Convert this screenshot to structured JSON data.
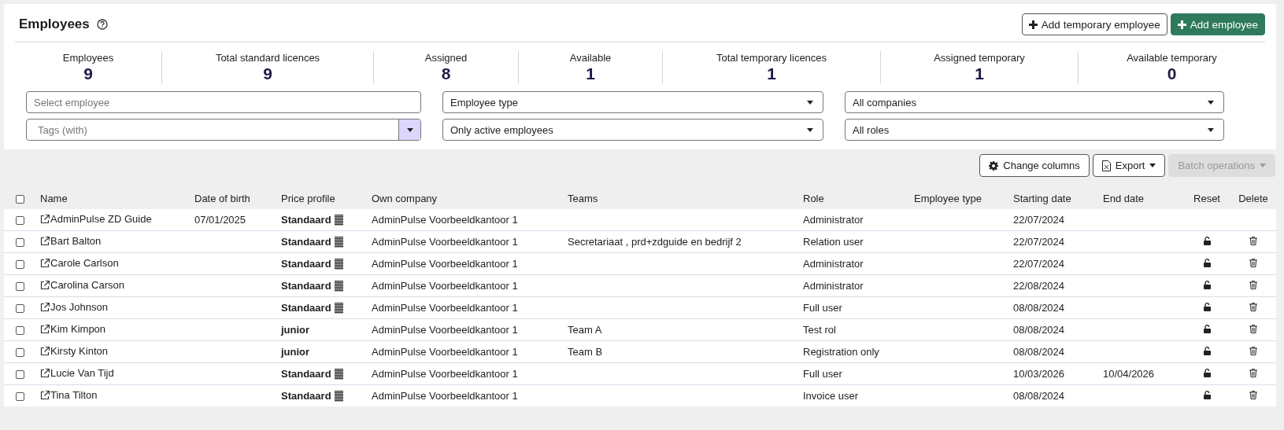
{
  "header": {
    "title": "Employees",
    "buttons": [
      {
        "label": "Add temporary employee",
        "kind": "secondary"
      },
      {
        "label": "Add employee",
        "kind": "primary"
      }
    ]
  },
  "stats": [
    {
      "label": "Employees",
      "value": "9"
    },
    {
      "label": "Total standard licences",
      "value": "9"
    },
    {
      "label": "Assigned",
      "value": "8"
    },
    {
      "label": "Available",
      "value": "1"
    },
    {
      "label": "Total temporary licences",
      "value": "1"
    },
    {
      "label": "Assigned temporary",
      "value": "1"
    },
    {
      "label": "Available temporary",
      "value": "0"
    }
  ],
  "filters": [
    {
      "kind": "text",
      "placeholder": "Select employee"
    },
    {
      "kind": "select",
      "value": "Employee type"
    },
    {
      "kind": "select",
      "value": "All companies"
    },
    {
      "kind": "tags",
      "placeholder": "Tags (with)"
    },
    {
      "kind": "select",
      "value": "Only active employees"
    },
    {
      "kind": "select",
      "value": "All roles"
    }
  ],
  "toolbar": [
    {
      "label": "Change columns",
      "kind": "columns",
      "disabled": false
    },
    {
      "label": "Export",
      "kind": "export",
      "disabled": false
    },
    {
      "label": "Batch operations",
      "kind": "batch",
      "disabled": true
    }
  ],
  "table": {
    "select_all_checked": false,
    "columns": [
      "Name",
      "Date of birth",
      "Price profile",
      "Own company",
      "Teams",
      "Role",
      "Employee type",
      "Starting date",
      "End date",
      "Reset",
      "Delete"
    ],
    "rows": [
      {
        "checked": false,
        "name": "AdminPulse ZD Guide",
        "date_of_birth": "07/01/2025",
        "price_profile": "Standaard",
        "price_icon": true,
        "own_company": "AdminPulse Voorbeeldkantoor 1",
        "teams": "",
        "role": "Administrator",
        "starting_date": "22/07/2024",
        "end_date": "",
        "resettable": false,
        "deletable": false
      },
      {
        "checked": false,
        "name": "Bart Balton",
        "date_of_birth": "",
        "price_profile": "Standaard",
        "price_icon": true,
        "own_company": "AdminPulse Voorbeeldkantoor 1",
        "teams": "Secretariaat , prd+zdguide en bedrijf 2",
        "role": "Relation user",
        "starting_date": "22/07/2024",
        "end_date": "",
        "resettable": true,
        "deletable": true
      },
      {
        "checked": false,
        "name": "Carole Carlson",
        "date_of_birth": "",
        "price_profile": "Standaard",
        "price_icon": true,
        "own_company": "AdminPulse Voorbeeldkantoor 1",
        "teams": "",
        "role": "Administrator",
        "starting_date": "22/07/2024",
        "end_date": "",
        "resettable": true,
        "deletable": true
      },
      {
        "checked": false,
        "name": "Carolina Carson",
        "date_of_birth": "",
        "price_profile": "Standaard",
        "price_icon": true,
        "own_company": "AdminPulse Voorbeeldkantoor 1",
        "teams": "",
        "role": "Administrator",
        "starting_date": "22/08/2024",
        "end_date": "",
        "resettable": true,
        "deletable": true
      },
      {
        "checked": false,
        "name": "Jos Johnson",
        "date_of_birth": "",
        "price_profile": "Standaard",
        "price_icon": true,
        "own_company": "AdminPulse Voorbeeldkantoor 1",
        "teams": "",
        "role": "Full user",
        "starting_date": "08/08/2024",
        "end_date": "",
        "resettable": true,
        "deletable": true
      },
      {
        "checked": false,
        "name": "Kim Kimpon",
        "date_of_birth": "",
        "price_profile": "junior",
        "price_icon": false,
        "own_company": "AdminPulse Voorbeeldkantoor 1",
        "teams": "Team A",
        "role": "Test rol",
        "starting_date": "08/08/2024",
        "end_date": "",
        "resettable": true,
        "deletable": true
      },
      {
        "checked": false,
        "name": "Kirsty Kinton",
        "date_of_birth": "",
        "price_profile": "junior",
        "price_icon": false,
        "own_company": "AdminPulse Voorbeeldkantoor 1",
        "teams": "Team B",
        "role": "Registration only",
        "starting_date": "08/08/2024",
        "end_date": "",
        "resettable": true,
        "deletable": true
      },
      {
        "checked": false,
        "name": "Lucie Van Tijd",
        "date_of_birth": "",
        "price_profile": "Standaard",
        "price_icon": true,
        "own_company": "AdminPulse Voorbeeldkantoor 1",
        "teams": "",
        "role": "Full user",
        "starting_date": "10/03/2026",
        "end_date": "10/04/2026",
        "resettable": true,
        "deletable": true
      },
      {
        "checked": false,
        "name": "Tina Tilton",
        "date_of_birth": "",
        "price_profile": "Standaard",
        "price_icon": true,
        "own_company": "AdminPulse Voorbeeldkantoor 1",
        "teams": "",
        "role": "Invoice user",
        "starting_date": "08/08/2024",
        "end_date": "",
        "resettable": true,
        "deletable": true
      }
    ]
  }
}
